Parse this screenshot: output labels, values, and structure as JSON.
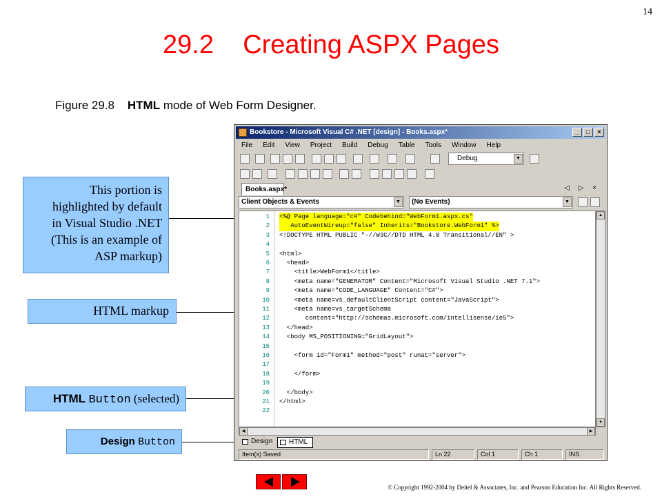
{
  "slide_number": "14",
  "title": "29.2    Creating ASPX Pages",
  "caption": {
    "figure": "Figure 29.8    ",
    "bold": "HTML",
    "rest": " mode of Web Form Designer."
  },
  "callouts": {
    "asp_highlight": [
      "This portion is",
      "highlighted by default",
      "in Visual Studio .NET",
      "(This is an example of",
      "ASP markup)"
    ],
    "html_markup": "HTML markup",
    "html_button_bold": "HTML ",
    "html_button_mono": "Button",
    "html_button_rest": " (selected)",
    "design_button_bold": "Design ",
    "design_button_mono": "Button"
  },
  "window": {
    "title": "Bookstore - Microsoft Visual C# .NET [design] - Books.aspx*",
    "controls": [
      "_",
      "□",
      "×"
    ],
    "menu": [
      "File",
      "Edit",
      "View",
      "Project",
      "Build",
      "Debug",
      "Table",
      "Tools",
      "Window",
      "Help"
    ],
    "config": "Debug",
    "doc_tab": "Books.aspx*",
    "tab_nav": "◁ ▷ ×",
    "combo_left": "Client Objects & Events",
    "combo_right": "(No Events)",
    "line_numbers": [
      "1",
      "2",
      "3",
      "4",
      "5",
      "6",
      "7",
      "8",
      "9",
      "10",
      "11",
      "12",
      "13",
      "14",
      "15",
      "16",
      "17",
      "18",
      "19",
      "20",
      "21",
      "22"
    ],
    "code_lines": [
      "<%@ Page language=\"c#\" Codebehind=\"WebForm1.aspx.cs\"",
      "   AutoEventWireup=\"false\" Inherits=\"Bookstore.WebForm1\" %>",
      "<!DOCTYPE HTML PUBLIC \"-//W3C//DTD HTML 4.0 Transitional//EN\" >",
      "",
      "<html>",
      "  <head>",
      "    <title>WebForm1</title>",
      "    <meta name=\"GENERATOR\" Content=\"Microsoft Visual Studio .NET 7.1\">",
      "    <meta name=\"CODE_LANGUAGE\" Content=\"C#\">",
      "    <meta name=vs_defaultClientScript content=\"JavaScript\">",
      "    <meta name=vs_targetSchema",
      "       content=\"http://schemas.microsoft.com/intellisense/ie5\">",
      "  </head>",
      "  <body MS_POSITIONING=\"GridLayout\">",
      "",
      "    <form id=\"Form1\" method=\"post\" runat=\"server\">",
      "",
      "    </form>",
      "",
      "  </body>",
      "</html>",
      ""
    ],
    "mode_design": "Design",
    "mode_html": "HTML",
    "status": {
      "message": "Item(s) Saved",
      "ln": "Ln 22",
      "col": "Col 1",
      "ch": "Ch 1",
      "ins": "INS"
    }
  },
  "copyright": "© Copyright 1992-2004 by Deitel & Associates, Inc. and Pearson Education Inc. All Rights Reserved."
}
